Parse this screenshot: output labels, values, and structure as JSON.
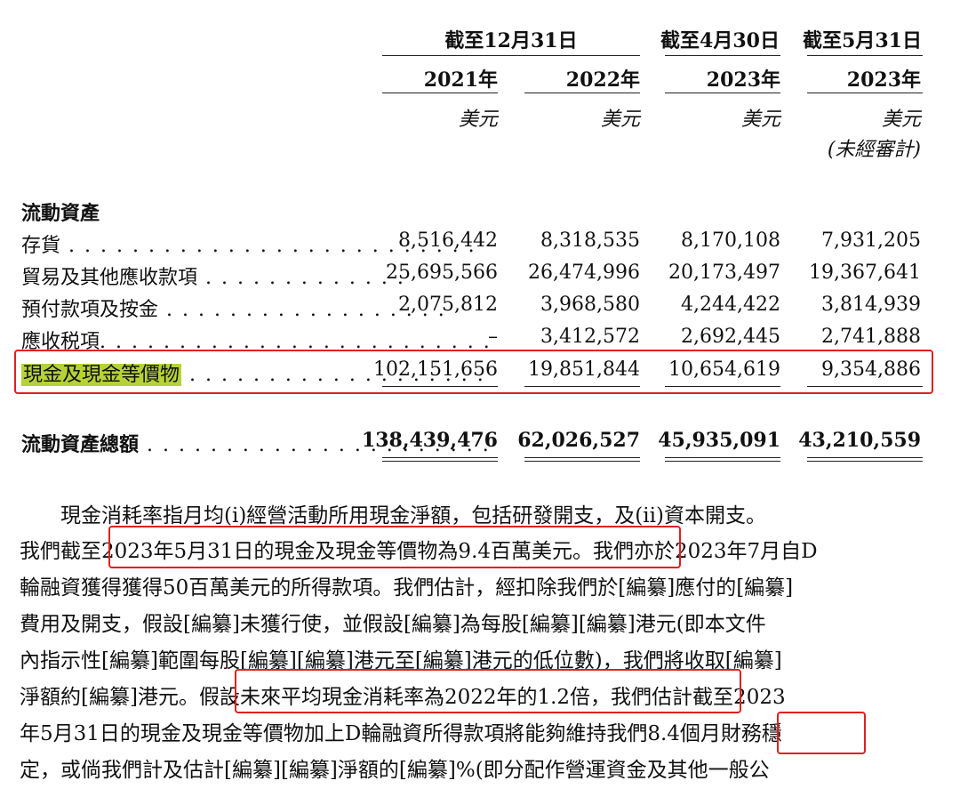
{
  "header": {
    "group1": "截至12月31日",
    "group2": "截至4月30日",
    "group3": "截至5月31日",
    "years": [
      "2021年",
      "2022年",
      "2023年",
      "2023年"
    ],
    "units": [
      "美元",
      "美元",
      "美元",
      "美元"
    ],
    "unaudited": "(未經審計)"
  },
  "section_title": "流動資產",
  "rows": [
    {
      "label": "存貨",
      "dots": " . . . . . . . . . . . . . . . . . . . . . . . . . .",
      "values": [
        "8,516,442",
        "8,318,535",
        "8,170,108",
        "7,931,205"
      ]
    },
    {
      "label": "貿易及其他應收款項",
      "dots": " . . . . . . . . . . . . .",
      "values": [
        "25,695,566",
        "26,474,996",
        "20,173,497",
        "19,367,641"
      ]
    },
    {
      "label": "預付款項及按金",
      "dots": " . . . . . . . . . . . . . . . . . .",
      "values": [
        "2,075,812",
        "3,968,580",
        "4,244,422",
        "3,814,939"
      ]
    },
    {
      "label": "應收税項",
      "dots": ". . . . . . . . . . . . . . . . . . . . . . . . .",
      "values": [
        "–",
        "3,412,572",
        "2,692,445",
        "2,741,888"
      ]
    },
    {
      "label": "現金及現金等價物",
      "dots": " . . . . . . . . . . . . . . . . . . .",
      "values": [
        "102,151,656",
        "19,851,844",
        "10,654,619",
        "9,354,886"
      ]
    }
  ],
  "total": {
    "label": "流動資產總額",
    "dots": " . . . . . . . . . . . . . . . . . . . . . .",
    "values": [
      "138,439,476",
      "62,026,527",
      "45,935,091",
      "43,210,559"
    ]
  },
  "paragraph": [
    "　　現金消耗率指月均(i)經營活動所用現金淨額，包括研發開支，及(ii)資本開支。",
    "我們截至2023年5月31日的現金及現金等價物為9.4百萬美元。我們亦於2023年7月自D",
    "輪融資獲得獲得50百萬美元的所得款項。我們估計，經扣除我們於[編纂]應付的[編纂]",
    "費用及開支，假設[編纂]未獲行使，並假設[編纂]為每股[編纂][編纂]港元(即本文件",
    "內指示性[編纂]範圍每股[編纂][編纂]港元至[編纂]港元的低位數)，我們將收取[編纂]",
    "淨額約[編纂]港元。假設未來平均現金消耗率為2022年的1.2倍，我們估計截至2023",
    "年5月31日的現金及現金等價物加上D輪融資所得款項將能夠維持我們8.4個月財務穩",
    "定，或倘我們計及估計[編纂][編纂]淨額的[編纂]%(即分配作營運資金及其他一般公"
  ]
}
